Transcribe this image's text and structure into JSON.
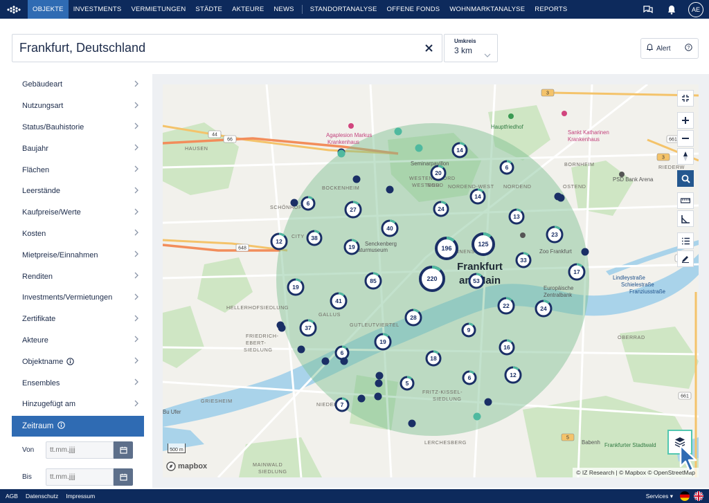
{
  "nav": {
    "logo_icon": "iz-logo-icon",
    "items": [
      {
        "label": "OBJEKTE",
        "active": true
      },
      {
        "label": "INVESTMENTS"
      },
      {
        "label": "VERMIETUNGEN"
      },
      {
        "label": "STÄDTE"
      },
      {
        "label": "AKTEURE"
      },
      {
        "label": "NEWS"
      },
      {
        "label": "STANDORTANALYSE"
      },
      {
        "label": "OFFENE FONDS"
      },
      {
        "label": "WOHNMARKTANALYSE"
      },
      {
        "label": "REPORTS"
      }
    ],
    "avatar": "AE",
    "icons": [
      "chat-icon",
      "bell-icon"
    ]
  },
  "search": {
    "value": "Frankfurt, Deutschland",
    "radius_label": "Umkreis",
    "radius_value": "3 km"
  },
  "alert": {
    "label": "Alert"
  },
  "filters": [
    {
      "label": "Gebäudeart"
    },
    {
      "label": "Nutzungsart"
    },
    {
      "label": "Status/Bauhistorie"
    },
    {
      "label": "Baujahr"
    },
    {
      "label": "Flächen"
    },
    {
      "label": "Leerstände"
    },
    {
      "label": "Kaufpreise/Werte"
    },
    {
      "label": "Kosten"
    },
    {
      "label": "Mietpreise/Einnahmen"
    },
    {
      "label": "Renditen"
    },
    {
      "label": "Investments/Vermietungen"
    },
    {
      "label": "Zertifikate"
    },
    {
      "label": "Akteure"
    },
    {
      "label": "Objektname",
      "info": true
    },
    {
      "label": "Ensembles"
    },
    {
      "label": "Hinzugefügt am"
    }
  ],
  "zeitraum": {
    "label": "Zeitraum",
    "von_label": "Von",
    "bis_label": "Bis",
    "date_placeholder": "tt.mm.jjjj"
  },
  "map": {
    "city_label_1": "Frankfurt",
    "city_label_2": "am Main",
    "districts": [
      "HAUSEN",
      "BOCKENHEIM",
      "WESTEND-NORD",
      "WESTEND",
      "NORD",
      "NORDEND-WEST",
      "NORDEND",
      "BORNHEIM",
      "OSTEND",
      "SCHÖNHOF",
      "CITY",
      "GALLUS",
      "GUTLEUTVIERTEL",
      "INNENSTADT",
      "HELLERHOFSIEDLUNG",
      "FRIEDRICH-",
      "EBERT-",
      "SIEDLUNG",
      "GRIESHEIM",
      "NIEDERRAD",
      "FRITZ-KISSEL-",
      "SIEDLUNG",
      "LERCHESBERG",
      "OBERRAD",
      "MAINWALD",
      "SIEDLUNG",
      "RIEDERW"
    ],
    "pois": [
      "Agaplesion Markus",
      "Krankenhaus",
      "Seminarpavillon",
      "Hauptfriedhof",
      "Sankt Katharinen",
      "Krankenhaus",
      "PSD Bank Arena",
      "Zoo Frankfurt",
      "Senckenberg",
      "Naturmuseum",
      "Europäische",
      "Zentralbank",
      "Frankfurter Stadtwald",
      "Lindleystraße",
      "Schielestraße",
      "Franziusstraße",
      "Bu Ufer",
      "Babenh"
    ],
    "roads": [
      "66",
      "648",
      "3",
      "3",
      "661",
      "661",
      "661",
      "44",
      "5"
    ],
    "clusters": [
      {
        "count": "14"
      },
      {
        "count": "20"
      },
      {
        "count": "6"
      },
      {
        "count": "14"
      },
      {
        "count": "6"
      },
      {
        "count": "27"
      },
      {
        "count": "24"
      },
      {
        "count": "13"
      },
      {
        "count": "38"
      },
      {
        "count": "40"
      },
      {
        "count": "12"
      },
      {
        "count": "19"
      },
      {
        "count": "196"
      },
      {
        "count": "125"
      },
      {
        "count": "23"
      },
      {
        "count": "33"
      },
      {
        "count": "17"
      },
      {
        "count": "220"
      },
      {
        "count": "53"
      },
      {
        "count": "85"
      },
      {
        "count": "19"
      },
      {
        "count": "41"
      },
      {
        "count": "22"
      },
      {
        "count": "24"
      },
      {
        "count": "37"
      },
      {
        "count": "28"
      },
      {
        "count": "9"
      },
      {
        "count": "19"
      },
      {
        "count": "16"
      },
      {
        "count": "6"
      },
      {
        "count": "18"
      },
      {
        "count": "6"
      },
      {
        "count": "12"
      },
      {
        "count": "5"
      },
      {
        "count": "7"
      }
    ],
    "scale": "500 m",
    "mapbox": "mapbox",
    "attribution": "© IZ Research | © Mapbox © OpenStreetMap",
    "tools": [
      "collapse-icon",
      "zoom-in-icon",
      "zoom-out-icon",
      "compass-icon",
      "search-zoom-icon",
      "ruler-icon",
      "angle-measure-icon",
      "list-icon",
      "pen-icon"
    ],
    "layers_icon": "layers-icon"
  },
  "footer": {
    "links": [
      "AGB",
      "Datenschutz",
      "Impressum"
    ],
    "services": "Services ▾",
    "flags": [
      "de-flag-icon",
      "uk-flag-icon"
    ]
  },
  "colors": {
    "nav_bg": "#0d2a5c",
    "accent": "#2f6bb3",
    "radius_circle": "#7fc29b",
    "marker": "#1a2f66",
    "marker_ring": "#4fb99f",
    "layers_border": "#52c7b0"
  }
}
